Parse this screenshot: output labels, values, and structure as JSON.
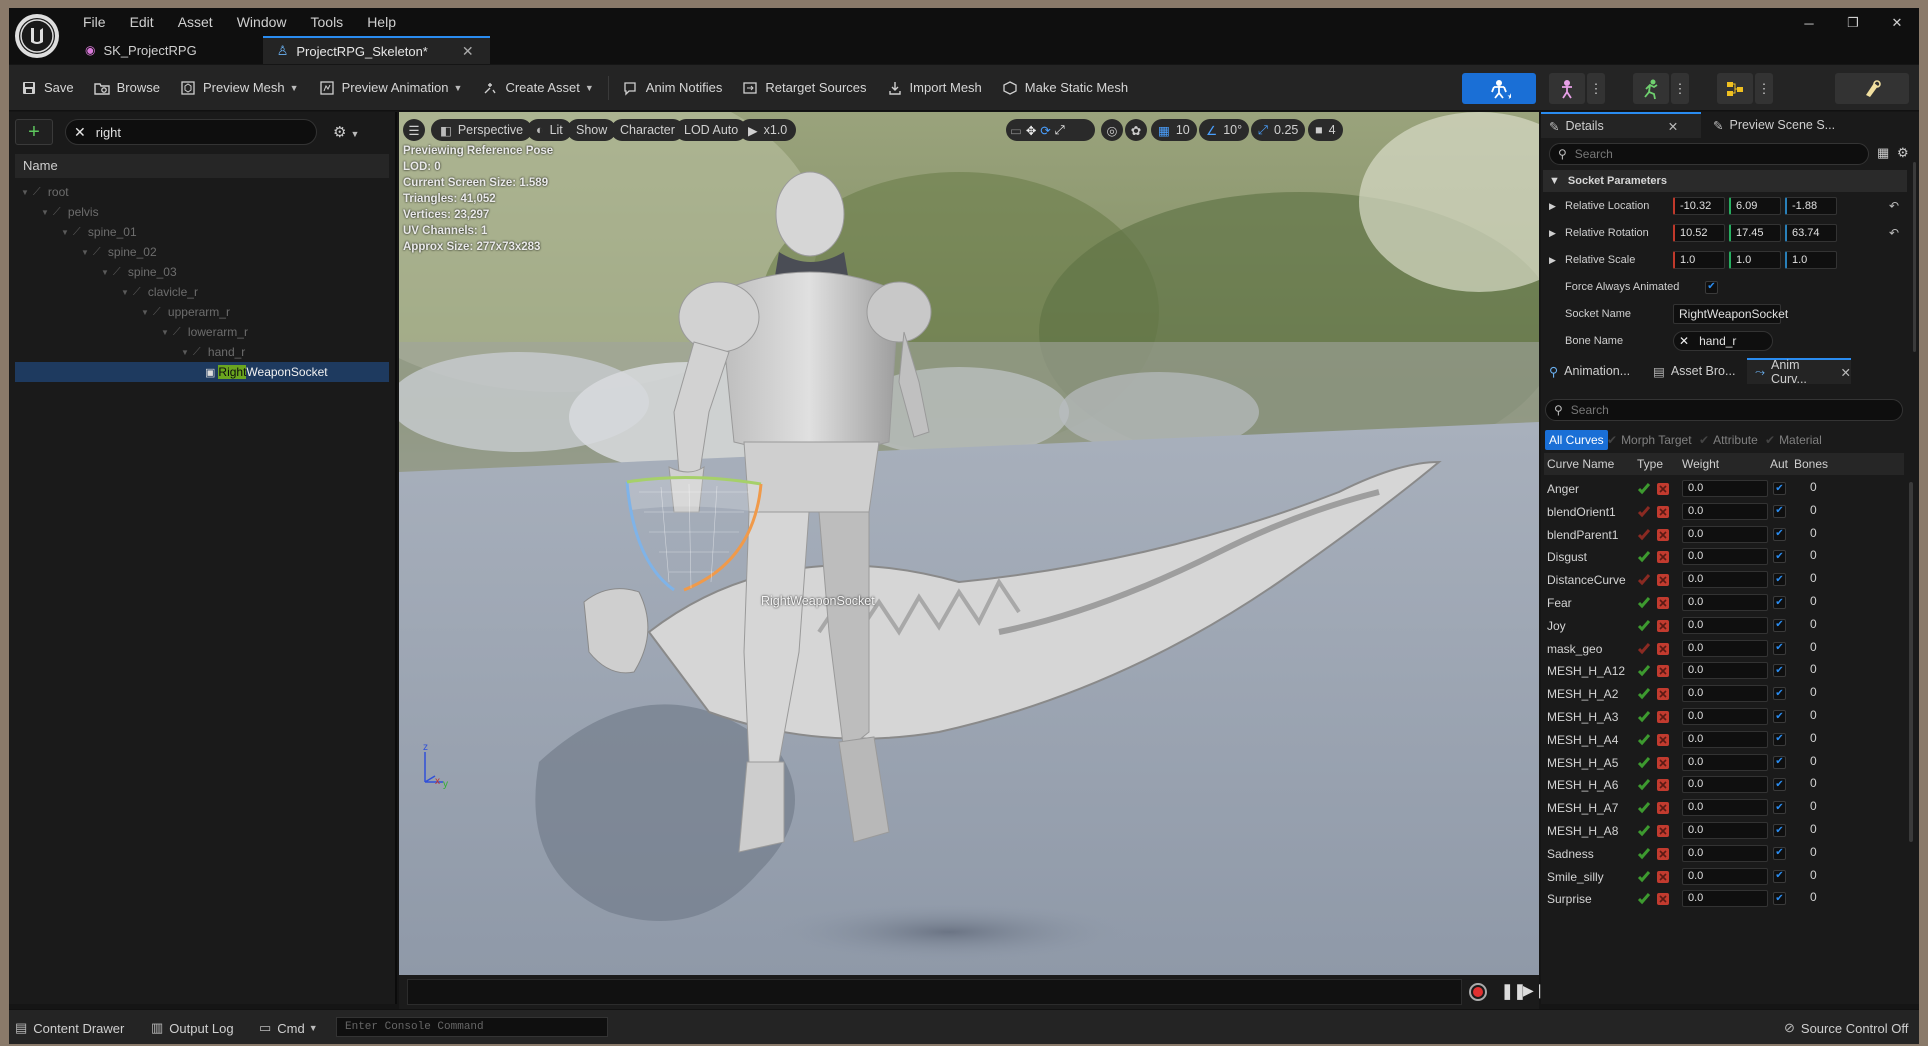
{
  "menu": [
    "File",
    "Edit",
    "Asset",
    "Window",
    "Tools",
    "Help"
  ],
  "tabs": [
    {
      "label": "SK_ProjectRPG"
    },
    {
      "label": "ProjectRPG_Skeleton*"
    }
  ],
  "window_buttons": [
    "─",
    "❐",
    "✕"
  ],
  "toolbar": {
    "save": "Save",
    "browse": "Browse",
    "preview_mesh": "Preview Mesh",
    "preview_animation": "Preview Animation",
    "create_asset": "Create Asset",
    "anim_notifies": "Anim Notifies",
    "retarget_sources": "Retarget Sources",
    "import_mesh": "Import Mesh",
    "make_static_mesh": "Make Static Mesh"
  },
  "skeleton_tree": {
    "search_value": "right",
    "header": "Name",
    "bones": [
      {
        "name": "root",
        "depth": 0
      },
      {
        "name": "pelvis",
        "depth": 1
      },
      {
        "name": "spine_01",
        "depth": 2
      },
      {
        "name": "spine_02",
        "depth": 3
      },
      {
        "name": "spine_03",
        "depth": 4
      },
      {
        "name": "clavicle_r",
        "depth": 5
      },
      {
        "name": "upperarm_r",
        "depth": 6
      },
      {
        "name": "lowerarm_r",
        "depth": 7
      },
      {
        "name": "hand_r",
        "depth": 8
      }
    ],
    "socket": {
      "match": "Right",
      "rest": "WeaponSocket",
      "depth": 9
    }
  },
  "viewport": {
    "perspective": "Perspective",
    "lit": "Lit",
    "show": "Show",
    "character": "Character",
    "lod": "LOD Auto",
    "speed": "x1.0",
    "stats": [
      "Previewing Reference Pose",
      "LOD: 0",
      "Current Screen Size: 1.589",
      "Triangles: 41,052",
      "Vertices: 23,297",
      "UV Channels: 1",
      "Approx Size: 277x73x283"
    ],
    "grid_snap": "10",
    "rot_snap": "10°",
    "scale_snap": "0.25",
    "camera_speed": "4",
    "socket_label": "RightWeaponSocket"
  },
  "details": {
    "tab": "Details",
    "tab2": "Preview Scene S...",
    "search_placeholder": "Search",
    "category": "Socket Parameters",
    "location": {
      "label": "Relative Location",
      "x": "-10.32",
      "y": "6.09",
      "z": "-1.88"
    },
    "rotation": {
      "label": "Relative Rotation",
      "x": "10.52",
      "y": "17.45",
      "z": "63.74"
    },
    "scale": {
      "label": "Relative Scale",
      "x": "1.0",
      "y": "1.0",
      "z": "1.0"
    },
    "force_label": "Force Always Animated",
    "socket_name_label": "Socket Name",
    "socket_name": "RightWeaponSocket",
    "bone_name_label": "Bone Name",
    "bone_name": "hand_r"
  },
  "curves_panel": {
    "tabs": [
      "Animation...",
      "Asset Bro...",
      "Anim Curv..."
    ],
    "search_placeholder": "Search",
    "filters": {
      "all": "All Curves",
      "morph": "Morph Target",
      "attribute": "Attribute",
      "material": "Material"
    },
    "columns": {
      "name": "Curve Name",
      "type": "Type",
      "weight": "Weight",
      "auto": "Aut",
      "bones": "Bones"
    },
    "rows": [
      {
        "name": "Anger",
        "morph": true,
        "weight": "0.0",
        "bones": "0"
      },
      {
        "name": "blendOrient1",
        "morph": false,
        "weight": "0.0",
        "bones": "0"
      },
      {
        "name": "blendParent1",
        "morph": false,
        "weight": "0.0",
        "bones": "0"
      },
      {
        "name": "Disgust",
        "morph": true,
        "weight": "0.0",
        "bones": "0"
      },
      {
        "name": "DistanceCurve",
        "morph": false,
        "weight": "0.0",
        "bones": "0"
      },
      {
        "name": "Fear",
        "morph": true,
        "weight": "0.0",
        "bones": "0"
      },
      {
        "name": "Joy",
        "morph": true,
        "weight": "0.0",
        "bones": "0"
      },
      {
        "name": "mask_geo",
        "morph": false,
        "weight": "0.0",
        "bones": "0"
      },
      {
        "name": "MESH_H_A12",
        "morph": true,
        "weight": "0.0",
        "bones": "0"
      },
      {
        "name": "MESH_H_A2",
        "morph": true,
        "weight": "0.0",
        "bones": "0"
      },
      {
        "name": "MESH_H_A3",
        "morph": true,
        "weight": "0.0",
        "bones": "0"
      },
      {
        "name": "MESH_H_A4",
        "morph": true,
        "weight": "0.0",
        "bones": "0"
      },
      {
        "name": "MESH_H_A5",
        "morph": true,
        "weight": "0.0",
        "bones": "0"
      },
      {
        "name": "MESH_H_A6",
        "morph": true,
        "weight": "0.0",
        "bones": "0"
      },
      {
        "name": "MESH_H_A7",
        "morph": true,
        "weight": "0.0",
        "bones": "0"
      },
      {
        "name": "MESH_H_A8",
        "morph": true,
        "weight": "0.0",
        "bones": "0"
      },
      {
        "name": "Sadness",
        "morph": true,
        "weight": "0.0",
        "bones": "0"
      },
      {
        "name": "Smile_silly",
        "morph": true,
        "weight": "0.0",
        "bones": "0"
      },
      {
        "name": "Surprise",
        "morph": true,
        "weight": "0.0",
        "bones": "0"
      }
    ]
  },
  "statusbar": {
    "content_drawer": "Content Drawer",
    "output_log": "Output Log",
    "cmd": "Cmd",
    "console_placeholder": "Enter Console Command",
    "source_control": "Source Control Off"
  },
  "colors": {
    "accent": "#2a8cf0",
    "selection": "#1e3a5f",
    "highlight": "#6aa51f",
    "morph_green": "#3d9a2f",
    "bone_red": "#c23b2f"
  }
}
